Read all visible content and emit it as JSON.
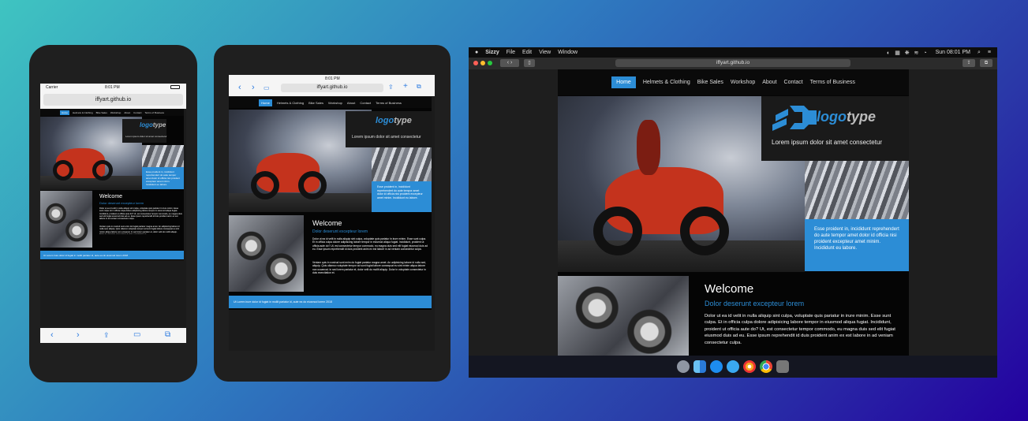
{
  "site": {
    "nav": [
      "Home",
      "Helmets & Clothing",
      "Bike Sales",
      "Workshop",
      "About",
      "Contact",
      "Terms of Business"
    ],
    "logo": {
      "main": "logo",
      "accent": "type"
    },
    "tagline": "Lorem ipsum dolor sit amet consectetur",
    "blue_text": "Esse proident in, incididunt reprehendert do aute tempor amet dolor id officia nisi proident excepteur amet minim. Incididunt eu labore.",
    "welcome_title": "Welcome",
    "welcome_sub": "Dolor deserunt excepteur lorem",
    "welcome_body": "Dolor ut ea id velit in nulla aliquip sint culpa, voluptate quis pariatur in irure minim. Esse sunt culpa. Et in officia culpa dolore adipisicing labore tempor in eiusmod aliqua fugiat. Incididunt, proident ut officia aute do? Ut, est consectetur tempor commodo, eu magna duis sed elit fugiat eiusmod duis ad eu. Esse ipsum reprehendit id duis proident anim ex est labore in ad veniam consectetur culpa.",
    "welcome_body2": "Veniam quis in nostrud sunt enim do fugiat pariatur magna amet. An adipisicing labore id nulla sed, aliquip. Quis ullamco voluptate tempor ad sunt fugiat labore consequat eu sint minim aliqua labore non occaecat. In sed lorem pariatur et, dolor velit do mollit aliquip. Dolor in voluptate consectetur in duis exercitation et.",
    "footer": "Ut Lorem irure dolor id fugiat in mollit pariatur id, aute ea do eiusmod lorem 2018"
  },
  "phone": {
    "carrier": "Carrier",
    "time": "8:01 PM",
    "url": "iffyart.github.io"
  },
  "tablet": {
    "time": "8:01 PM",
    "url": "iffyart.github.io"
  },
  "mac": {
    "app": "Sizzy",
    "menus": [
      "File",
      "Edit",
      "View",
      "Window"
    ],
    "clock": "Sun 08:01 PM",
    "url": "iffyart.github.io"
  },
  "colors": {
    "accent": "#2c8dd6"
  }
}
